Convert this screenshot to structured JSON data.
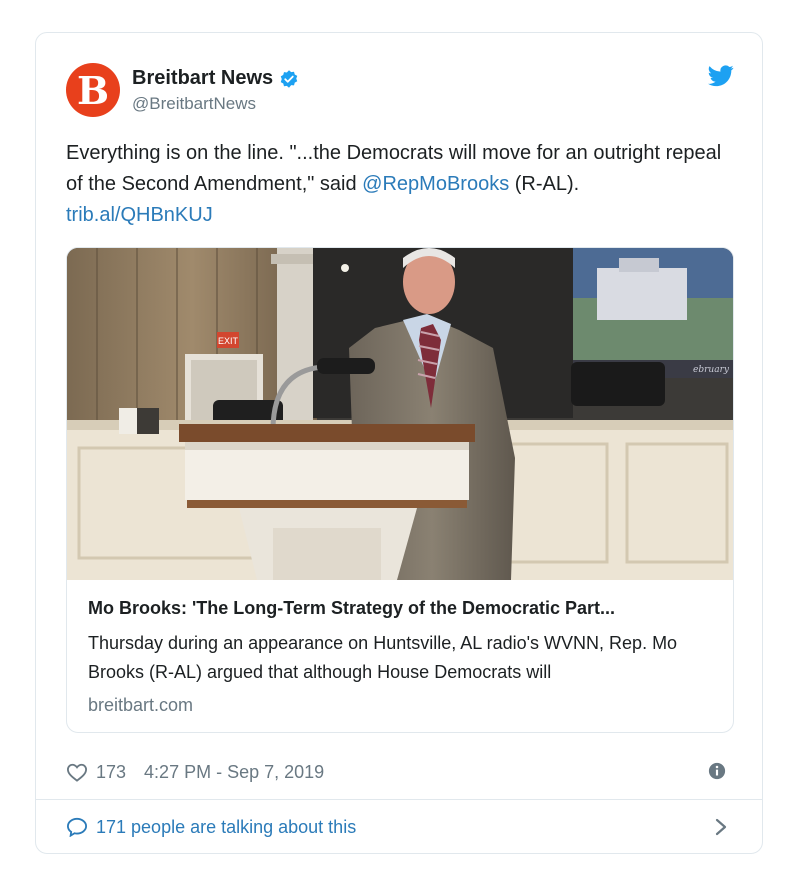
{
  "tweet": {
    "author": {
      "name": "Breitbart News",
      "handle": "@BreitbartNews",
      "avatar_letter": "B",
      "avatar_color": "#e8401c",
      "verified": true
    },
    "text_before_quote": "Everything is on the line. \"...the Democrats will move for an outright repeal of the Second Amendment,\" said ",
    "mention": "@RepMoBrooks",
    "text_middle": " (R-AL). ",
    "link": "trib.al/QHBnKUJ",
    "card": {
      "title": "Mo Brooks: 'The Long-Term Strategy of the Democratic Part...",
      "description": "Thursday during an appearance on Huntsville, AL radio's WVNN, Rep. Mo Brooks (R-AL) argued that although House Democrats will",
      "domain": "breitbart.com",
      "image_exit_sign": "EXIT",
      "image_screen_text": "ebruary"
    },
    "likes": "173",
    "timestamp": "4:27 PM - Sep 7, 2019",
    "footer_text": "171 people are talking about this"
  },
  "colors": {
    "link": "#2b7bb9",
    "text": "#1c2022",
    "muted": "#697882",
    "border": "#e1e8ed",
    "twitter_blue": "#1da1f2"
  },
  "icons": [
    "verified-badge-icon",
    "twitter-bird-icon",
    "heart-icon",
    "info-icon",
    "speech-bubble-icon",
    "chevron-right-icon"
  ]
}
